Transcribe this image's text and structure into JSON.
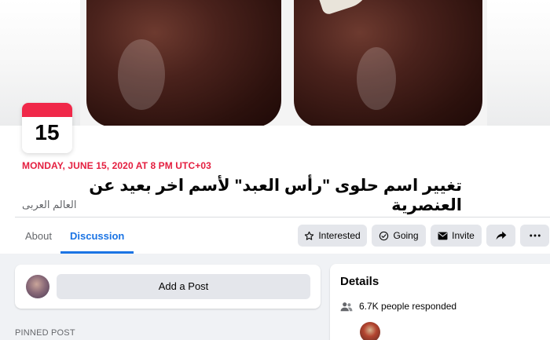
{
  "event": {
    "day": "15",
    "date_line": "MONDAY, JUNE 15, 2020 AT 8 PM UTC+03",
    "title": "تغيير اسم حلوى \"رأس العبد\" لأسم اخر بعيد عن العنصرية",
    "host": "العالم العربى"
  },
  "tabs": [
    "About",
    "Discussion"
  ],
  "active_tab": "Discussion",
  "actions": {
    "interested": "Interested",
    "going": "Going",
    "invite": "Invite"
  },
  "post_box": {
    "add_post_label": "Add a Post"
  },
  "pinned_label": "PINNED POST",
  "details": {
    "title": "Details",
    "responded": "6.7K people responded"
  },
  "colors": {
    "accent": "#1b74e4",
    "date_red": "#e41e3f",
    "badge_band": "#f02849",
    "button_bg": "#e4e6eb",
    "page_bg": "#f0f2f5"
  }
}
